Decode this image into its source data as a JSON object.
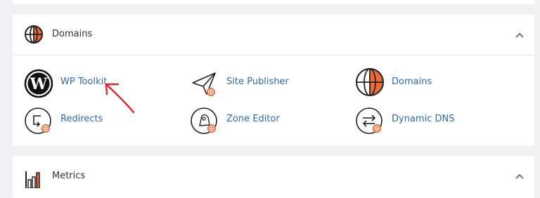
{
  "domains_section": {
    "title": "Domains",
    "items": [
      {
        "label": "WP Toolkit",
        "icon": "wordpress-icon"
      },
      {
        "label": "Site Publisher",
        "icon": "paper-plane-icon"
      },
      {
        "label": "Domains",
        "icon": "globe-icon"
      },
      {
        "label": "Redirects",
        "icon": "redirect-icon"
      },
      {
        "label": "Zone Editor",
        "icon": "zone-editor-icon"
      },
      {
        "label": "Dynamic DNS",
        "icon": "dynamic-dns-icon"
      }
    ]
  },
  "metrics_section": {
    "title": "Metrics"
  },
  "colors": {
    "accent_orange": "#ee6a34",
    "link_blue": "#2f6aa8",
    "annotation_red": "#d9262c"
  }
}
